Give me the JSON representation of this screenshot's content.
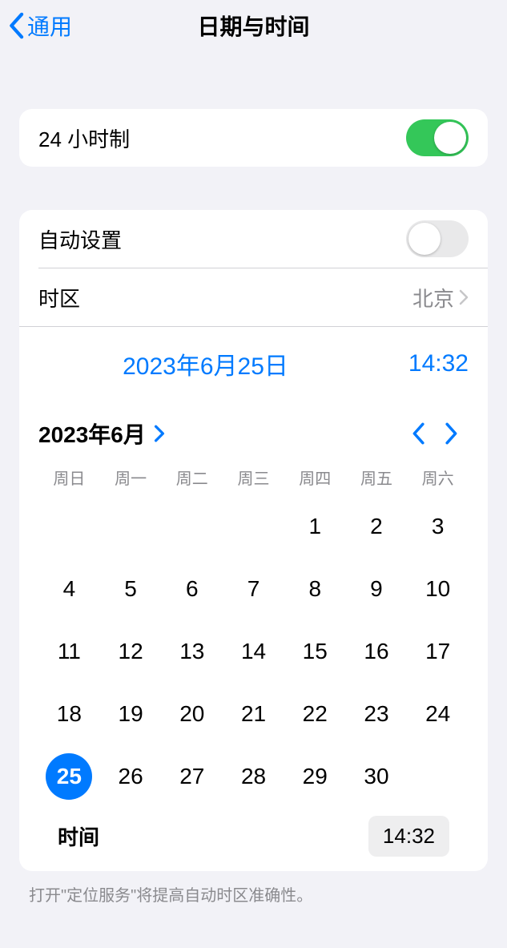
{
  "nav": {
    "back_label": "通用",
    "title": "日期与时间"
  },
  "section_24h": {
    "label": "24 小时制",
    "on": true
  },
  "auto": {
    "label": "自动设置",
    "on": false
  },
  "timezone": {
    "label": "时区",
    "value": "北京"
  },
  "summary": {
    "date": "2023年6月25日",
    "time": "14:32"
  },
  "calendar": {
    "month_label": "2023年6月",
    "weekdays": [
      "周日",
      "周一",
      "周二",
      "周三",
      "周四",
      "周五",
      "周六"
    ],
    "leading_blanks": 4,
    "days": [
      1,
      2,
      3,
      4,
      5,
      6,
      7,
      8,
      9,
      10,
      11,
      12,
      13,
      14,
      15,
      16,
      17,
      18,
      19,
      20,
      21,
      22,
      23,
      24,
      25,
      26,
      27,
      28,
      29,
      30
    ],
    "selected": 25
  },
  "time_row": {
    "label": "时间",
    "value": "14:32"
  },
  "footer": "打开\"定位服务\"将提高自动时区准确性。"
}
